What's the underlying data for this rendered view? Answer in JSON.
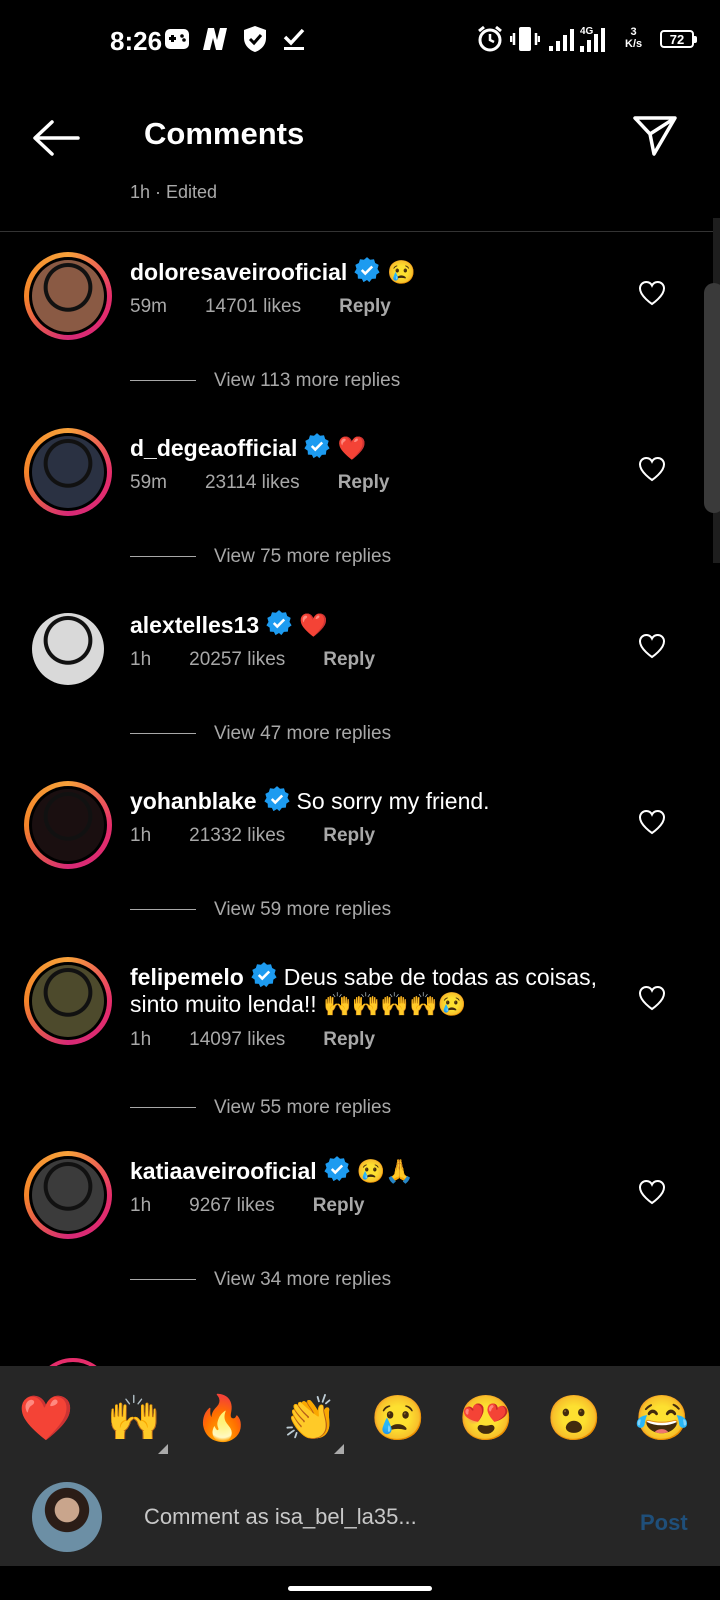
{
  "status_bar": {
    "time": "8:26",
    "network_label": "4G",
    "speed_value": "3",
    "speed_unit": "K/s",
    "battery": "72"
  },
  "header": {
    "title": "Comments",
    "edited_text": "1h · Edited"
  },
  "comments": [
    {
      "username": "doloresaveirooficial",
      "text": "😢",
      "time": "59m",
      "likes": "14701 likes",
      "reply": "Reply",
      "view_replies": "View 113 more replies",
      "ring": true,
      "avatar_color": "#8a5a44"
    },
    {
      "username": "d_degeaofficial",
      "text": "❤️",
      "time": "59m",
      "likes": "23114 likes",
      "reply": "Reply",
      "view_replies": "View 75 more replies",
      "ring": true,
      "avatar_color": "#2a3142"
    },
    {
      "username": "alextelles13",
      "text": "❤️",
      "time": "1h",
      "likes": "20257 likes",
      "reply": "Reply",
      "view_replies": "View 47 more replies",
      "ring": false,
      "avatar_color": "#d9d9d9"
    },
    {
      "username": "yohanblake",
      "text": "So sorry my friend.",
      "time": "1h",
      "likes": "21332 likes",
      "reply": "Reply",
      "view_replies": "View 59 more replies",
      "ring": true,
      "avatar_color": "#1a0f10"
    },
    {
      "username": "felipemelo",
      "text": "Deus sabe de todas as coisas,",
      "text2": "sinto muito lenda!! 🙌🙌🙌🙌😢",
      "time": "1h",
      "likes": "14097 likes",
      "reply": "Reply",
      "view_replies": "View 55 more replies",
      "ring": true,
      "avatar_color": "#4d4a2c"
    },
    {
      "username": "katiaaveirooficial",
      "text": "😢🙏",
      "time": "1h",
      "likes": "9267 likes",
      "reply": "Reply",
      "view_replies": "View 34 more replies",
      "ring": true,
      "avatar_color": "#3b3b3b"
    }
  ],
  "emoji_bar": [
    "❤️",
    "🙌",
    "🔥",
    "👏",
    "😢",
    "😍",
    "😮",
    "😂"
  ],
  "composer": {
    "placeholder": "Comment as isa_bel_la35...",
    "post_label": "Post"
  },
  "colors": {
    "background": "#000000",
    "panel": "#262626",
    "verified": "#1d9bf0",
    "secondary_text": "#a8a8a8",
    "post_disabled": "#1f4f7a"
  }
}
